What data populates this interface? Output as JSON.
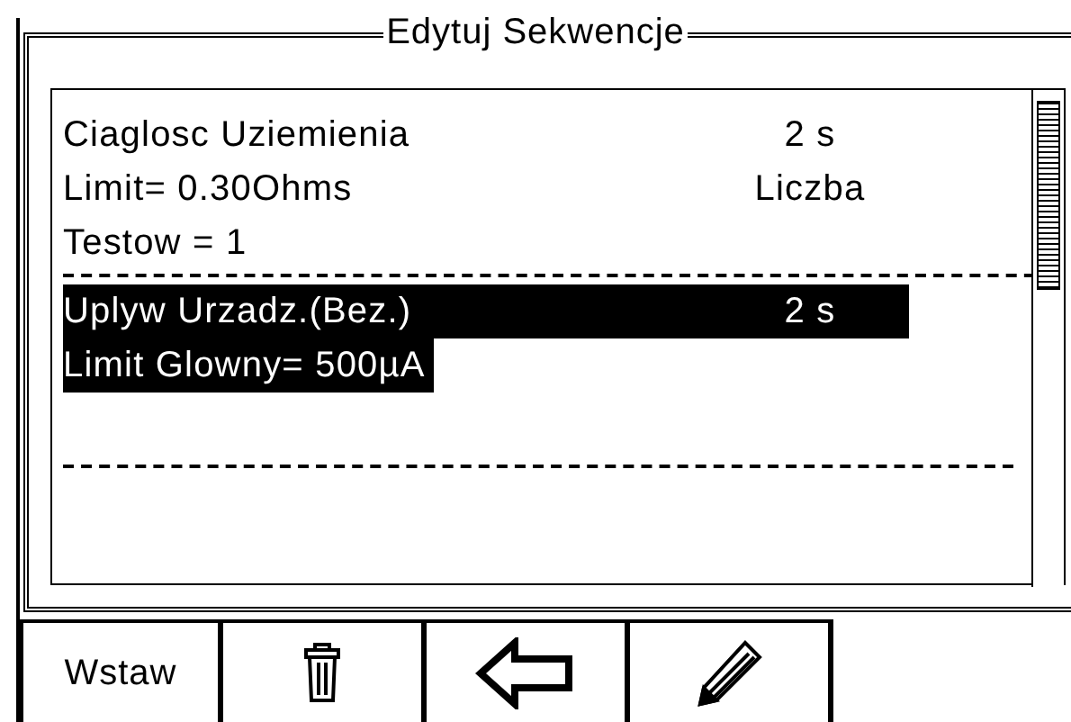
{
  "window": {
    "title": "Edytuj Sekwencje"
  },
  "sequence": [
    {
      "selected": false,
      "lines": [
        {
          "text": "Ciaglosc Uziemienia",
          "value": "2 s"
        },
        {
          "text": "Limit= 0.30Ohms",
          "value": "Liczba"
        },
        {
          "text": "Testow = 1"
        }
      ]
    },
    {
      "selected": true,
      "lines": [
        {
          "text": "Uplyw Urzadz.(Bez.)",
          "value": "2 s"
        },
        {
          "text": "Limit Glowny= 500µA "
        }
      ]
    }
  ],
  "softkeys": [
    {
      "kind": "text",
      "label": "Wstaw"
    },
    {
      "kind": "delete"
    },
    {
      "kind": "back"
    },
    {
      "kind": "edit"
    }
  ]
}
